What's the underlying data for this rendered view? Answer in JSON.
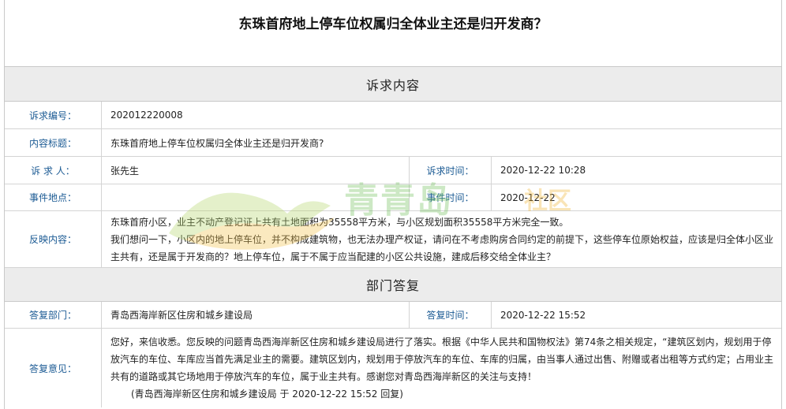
{
  "title": "东珠首府地上停车位权属归全体业主还是归开发商？",
  "section_request": "诉求内容",
  "request": {
    "id_label": "诉求编号：",
    "id_value": "202012220008",
    "subject_label": "内容标题：",
    "subject_value": "东珠首府地上停车位权属归全体业主还是归开发商?",
    "person_label": "诉 求 人：",
    "person_value": "张先生",
    "time_label": "诉求时间：",
    "time_value": "2020-12-22 10:28",
    "place_label": "事件地点：",
    "place_value": "",
    "event_time_label": "事件时间：",
    "event_time_value": "2020-12-22",
    "content_label": "反映内容：",
    "content_lines": [
      "东珠首府小区，业主不动产登记证上共有土地面积为35558平方米，与小区规划面积35558平方米完全一致。",
      "我们想问一下，小区内的地上停车位，并不构成建筑物，也无法办理产权证，请问在不考虑购房合同约定的前提下，这些停车位原始权益，应该是归全体小区业",
      "主共有，还是属于开发商的？地上停车位，属于不属于应当配建的小区公共设施，建成后移交给全体业主？"
    ]
  },
  "section_reply": "部门答复",
  "reply": {
    "dept_label": "答复部门：",
    "dept_value": "青岛西海岸新区住房和城乡建设局",
    "time_label": "答复时间：",
    "time_value": "2020-12-22 15:52",
    "opinion_label": "答复意见：",
    "opinion_lines": [
      "您好，来信收悉。您反映的问题青岛西海岸新区住房和城乡建设局进行了落实。根据《中华人民共和国物权法》第74条之相关规定，“建筑区划内，规划用于停",
      "放汽车的车位、车库应当首先满足业主的需要。建筑区划内，规划用于停放汽车的车位、车库的归属，由当事人通过出售、附赠或者出租等方式约定；占用业主",
      "共有的道路或其它场地用于停放汽车的车位，属于业主共有。感谢您对青岛西海岸新区的关注与支持！"
    ],
    "signoff": "(青岛西海岸新区住房和城乡建设局 于 2020-12-22 15:52 回复)"
  },
  "watermark": {
    "text": "青青岛",
    "sub": "社区",
    "colors": {
      "green": "#6fbf5a",
      "orange": "#f0b332"
    }
  }
}
